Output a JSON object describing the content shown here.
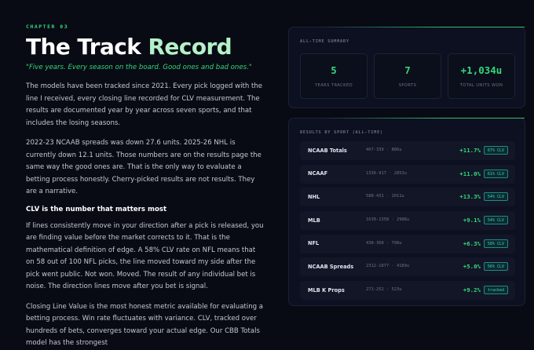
{
  "chapter": "CHAPTER 03",
  "title_main": "The Track ",
  "title_accent": "Record",
  "quote": "\"Five years. Every season on the board. Good ones and bad ones.\"",
  "paragraphs": [
    "The models have been tracked since 2021. Every pick logged with the line I received, every closing line recorded for CLV measurement. The results are documented year by year across seven sports, and that includes the losing seasons.",
    "2022-23 NCAAB spreads was down 27.6 units. 2025-26 NHL is currently down 12.1 units. Those numbers are on the results page the same way the good ones are. That is the only way to evaluate a betting process honestly. Cherry-picked results are not results. They are a narrative.",
    "If lines consistently move in your direction after a pick is released, you are finding value before the market corrects to it. That is the mathematical definition of edge. A 58% CLV rate on NFL means that on 58 out of 100 NFL picks, the line moved toward my side after the pick went public. Not won. Moved. The result of any individual bet is noise. The direction lines move after you bet is signal.",
    "Closing Line Value is the most honest metric available for evaluating a betting process. Win rate fluctuates with variance. CLV, tracked over hundreds of bets, converges toward your actual edge. Our CBB Totals model has the strongest"
  ],
  "subheading": "CLV is the number that matters most",
  "summary": {
    "label": "ALL-TIME SUMMARY",
    "stats": [
      {
        "value": "5",
        "label": "YEARS TRACKED"
      },
      {
        "value": "7",
        "label": "SPORTS"
      },
      {
        "value": "+1,034u",
        "label": "TOTAL UNITS WON"
      }
    ]
  },
  "results": {
    "label": "RESULTS BY SPORT (ALL-TIME)",
    "rows": [
      {
        "sport": "NCAAB Totals",
        "record": "467-339 · 886u",
        "roi": "+11.7%",
        "clv": "67% CLV"
      },
      {
        "sport": "NCAAF",
        "record": "1336-917 · 2853u",
        "roi": "+11.0%",
        "clv": "61% CLV"
      },
      {
        "sport": "NHL",
        "record": "588-431 · 1011u",
        "roi": "+13.3%",
        "clv": "54% CLV"
      },
      {
        "sport": "MLB",
        "record": "1630-1358 · 2988u",
        "roi": "+9.1%",
        "clv": "54% CLV"
      },
      {
        "sport": "NFL",
        "record": "438-368 · 798u",
        "roi": "+6.3%",
        "clv": "58% CLV"
      },
      {
        "sport": "NCAAB Spreads",
        "record": "2312-1877 · 4189u",
        "roi": "+5.0%",
        "clv": "56% CLV"
      },
      {
        "sport": "MLB K Props",
        "record": "271-252 · 523u",
        "roi": "+9.2%",
        "clv": "tracked"
      }
    ]
  }
}
